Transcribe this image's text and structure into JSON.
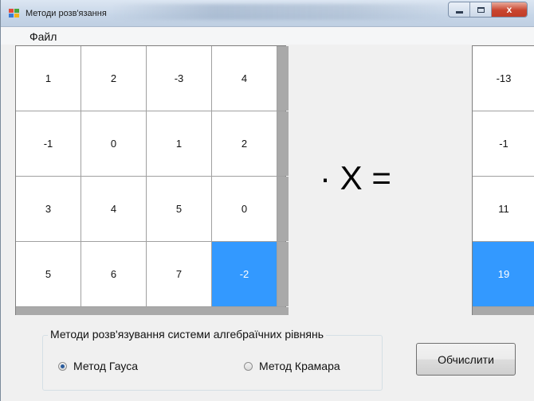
{
  "window": {
    "title": "Методи розв'язання",
    "controls": {
      "minimize": "–",
      "maximize": "□",
      "close": "x"
    }
  },
  "menu": {
    "items": [
      "Файл"
    ]
  },
  "matrix_a": {
    "rows": [
      [
        "1",
        "2",
        "-3",
        "4"
      ],
      [
        "-1",
        "0",
        "1",
        "2"
      ],
      [
        "3",
        "4",
        "5",
        "0"
      ],
      [
        "5",
        "6",
        "7",
        "-2"
      ]
    ],
    "selected": [
      3,
      3
    ]
  },
  "equation": {
    "text": "· X ="
  },
  "vector_b": {
    "values": [
      "-13",
      "-1",
      "11",
      "19"
    ],
    "selected": 3
  },
  "methods": {
    "title": "Методи розв'язування системи алгебраїчних рівнянь",
    "gauss_label": "Метод Гауса",
    "cramer_label": "Метод Крамара",
    "selected": "gauss"
  },
  "actions": {
    "compute_label": "Обчислити"
  },
  "colors": {
    "selection": "#3399ff",
    "window_bg": "#f0f0f0"
  }
}
